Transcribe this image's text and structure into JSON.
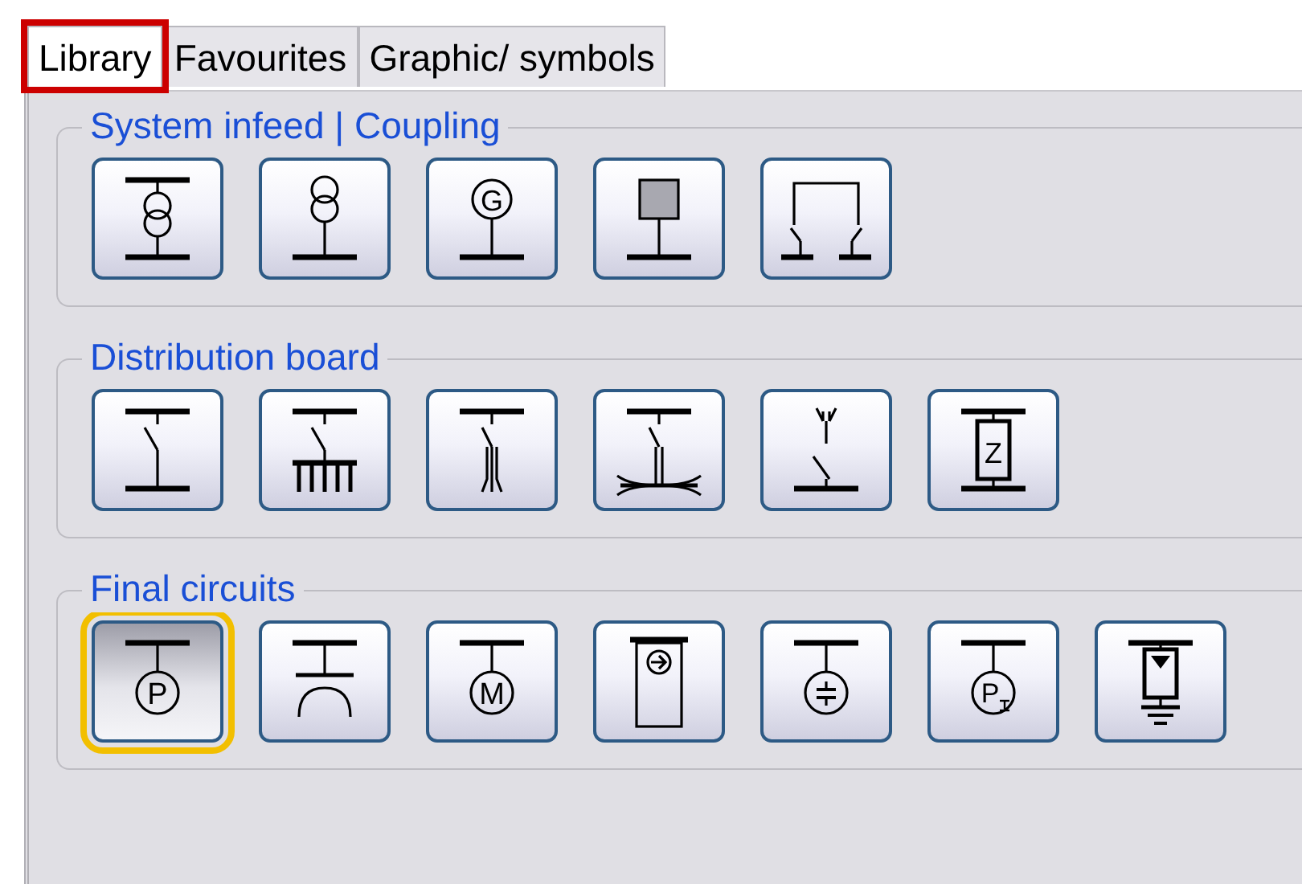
{
  "tabs": [
    {
      "label": "Library",
      "selected": true,
      "highlighted": true
    },
    {
      "label": "Favourites",
      "selected": false,
      "highlighted": false
    },
    {
      "label": "Graphic/ symbols",
      "selected": false,
      "highlighted": false
    }
  ],
  "groups": [
    {
      "title": "System infeed | Coupling",
      "buttons": [
        {
          "kind": "transformer-busbar",
          "selected": false
        },
        {
          "kind": "transformer",
          "selected": false
        },
        {
          "kind": "generator",
          "symbol": "G",
          "selected": false
        },
        {
          "kind": "source-block",
          "selected": false
        },
        {
          "kind": "coupling",
          "selected": false
        }
      ]
    },
    {
      "title": "Distribution board",
      "buttons": [
        {
          "kind": "switch",
          "selected": false
        },
        {
          "kind": "switch-multi",
          "selected": false
        },
        {
          "kind": "fuse-switch",
          "selected": false
        },
        {
          "kind": "switch-cable",
          "selected": false
        },
        {
          "kind": "plug-switch",
          "selected": false
        },
        {
          "kind": "impedance",
          "symbol": "Z",
          "selected": false
        }
      ]
    },
    {
      "title": "Final circuits",
      "buttons": [
        {
          "kind": "consumer",
          "symbol": "P",
          "selected": true
        },
        {
          "kind": "socket",
          "selected": false
        },
        {
          "kind": "motor",
          "symbol": "M",
          "selected": false
        },
        {
          "kind": "charger",
          "selected": false
        },
        {
          "kind": "capacitor",
          "selected": false
        },
        {
          "kind": "consumer-sub",
          "symbol": "P",
          "selected": false
        },
        {
          "kind": "grounding",
          "selected": false
        }
      ]
    }
  ]
}
